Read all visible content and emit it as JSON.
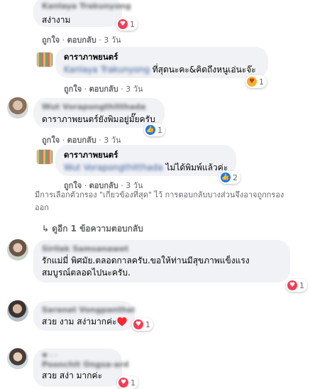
{
  "c1": {
    "author": "Kanlaya Trakunyong",
    "text": "สง่างาม",
    "reaction_count": "1",
    "like": "ถูกใจ",
    "reply": "ตอบกลับ",
    "time": "3 วัน"
  },
  "r1": {
    "author": "ดาราภาพยนตร์",
    "mention": "Kanlaya Trakunyong",
    "text": " ที่สุดนะคะ&คิดถึงหนูเอ่นะจ๊ะ",
    "reaction_count": "1",
    "like": "ถูกใจ",
    "reply": "ตอบกลับ",
    "time": "3 วัน"
  },
  "c2": {
    "author": "Wut Vorapongthitthada",
    "text": "ดาราภาพยนตร์ยังพิมอยู่มั๊ยครับ",
    "reaction_count": "1",
    "like": "ถูกใจ",
    "reply": "ตอบกลับ",
    "time": "3 วัน"
  },
  "r2": {
    "author": "ดาราภาพยนตร์",
    "mention": "Wut Vorapongthitthada",
    "text": " ไม่ได้พิมพ์แล้วค่ะ",
    "reaction_count": "2",
    "like": "ถูกใจ",
    "reply": "ตอบกลับ",
    "time": "3 วัน"
  },
  "filter_note": "มีการเลือกตัวกรอง \"เกี่ยวข้องที่สุด\" ไว้ การตอบกลับบางส่วนจึงอาจถูกกรองออก",
  "more_replies": "ดูอีก 1 ข้อความตอบกลับ",
  "c3": {
    "author": "Sirilak Samsanawet",
    "text_line1": "รักแม่มี่ พิศมัย.ตลอดกาลครับ.ขอให้ท่านมีสุขภาพแข็งแรง",
    "text_line2": "สมบูรณ์ตลอดไปนะครับ.",
    "reaction_count": "1"
  },
  "c4": {
    "author": "Saranat Vongpanthai",
    "text": "สวย งาม สง่ามากค่ะ♥️",
    "reaction_count": "1"
  },
  "c5": {
    "author": "Poonchit Ongsa-ard",
    "text": "สวย สง่า มากค่ะ",
    "reaction_count": "1"
  }
}
